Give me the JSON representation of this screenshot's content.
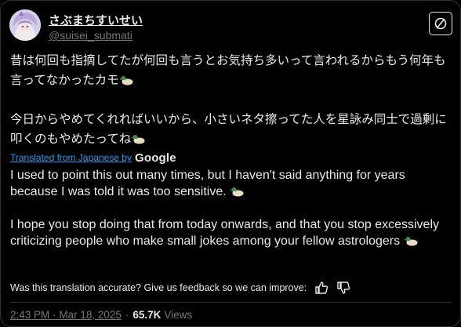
{
  "author": {
    "display_name": "さぶまちすいせい",
    "handle": "@suisei_submati"
  },
  "post": {
    "original_paragraphs": [
      "昔は何回も指摘してたが何回も言うとお気持ち多いって言われるからもう何年も言ってなかったカモ",
      "今日からやめてくれればいいから、小さいネタ擦ってた人を星詠み同士で過剰に叩くのもやめたってね"
    ],
    "translated_by_label": "Translated from Japanese by",
    "translator_brand": "Google",
    "translated_paragraphs": [
      "I used to point this out many times, but I haven't said anything for years because I was told it was too sensitive.",
      "I hope you stop doing that from today onwards, and that you stop excessively criticizing people who make small jokes among your fellow astrologers"
    ],
    "feedback_prompt": "Was this translation accurate? Give us feedback so we can improve:",
    "time": "2:43 PM",
    "date": "Mar 18, 2025",
    "separator": "·",
    "view_count": "65.7K",
    "views_label": "Views"
  },
  "colors": {
    "background": "#000000",
    "text": "#e7e9ea",
    "muted": "#71767b",
    "link": "#1d9bf0",
    "border": "#2f3336"
  },
  "icons": [
    "avatar",
    "x-logo-icon",
    "duck-emoji-icon",
    "thumbs-up-icon",
    "thumbs-down-icon"
  ]
}
